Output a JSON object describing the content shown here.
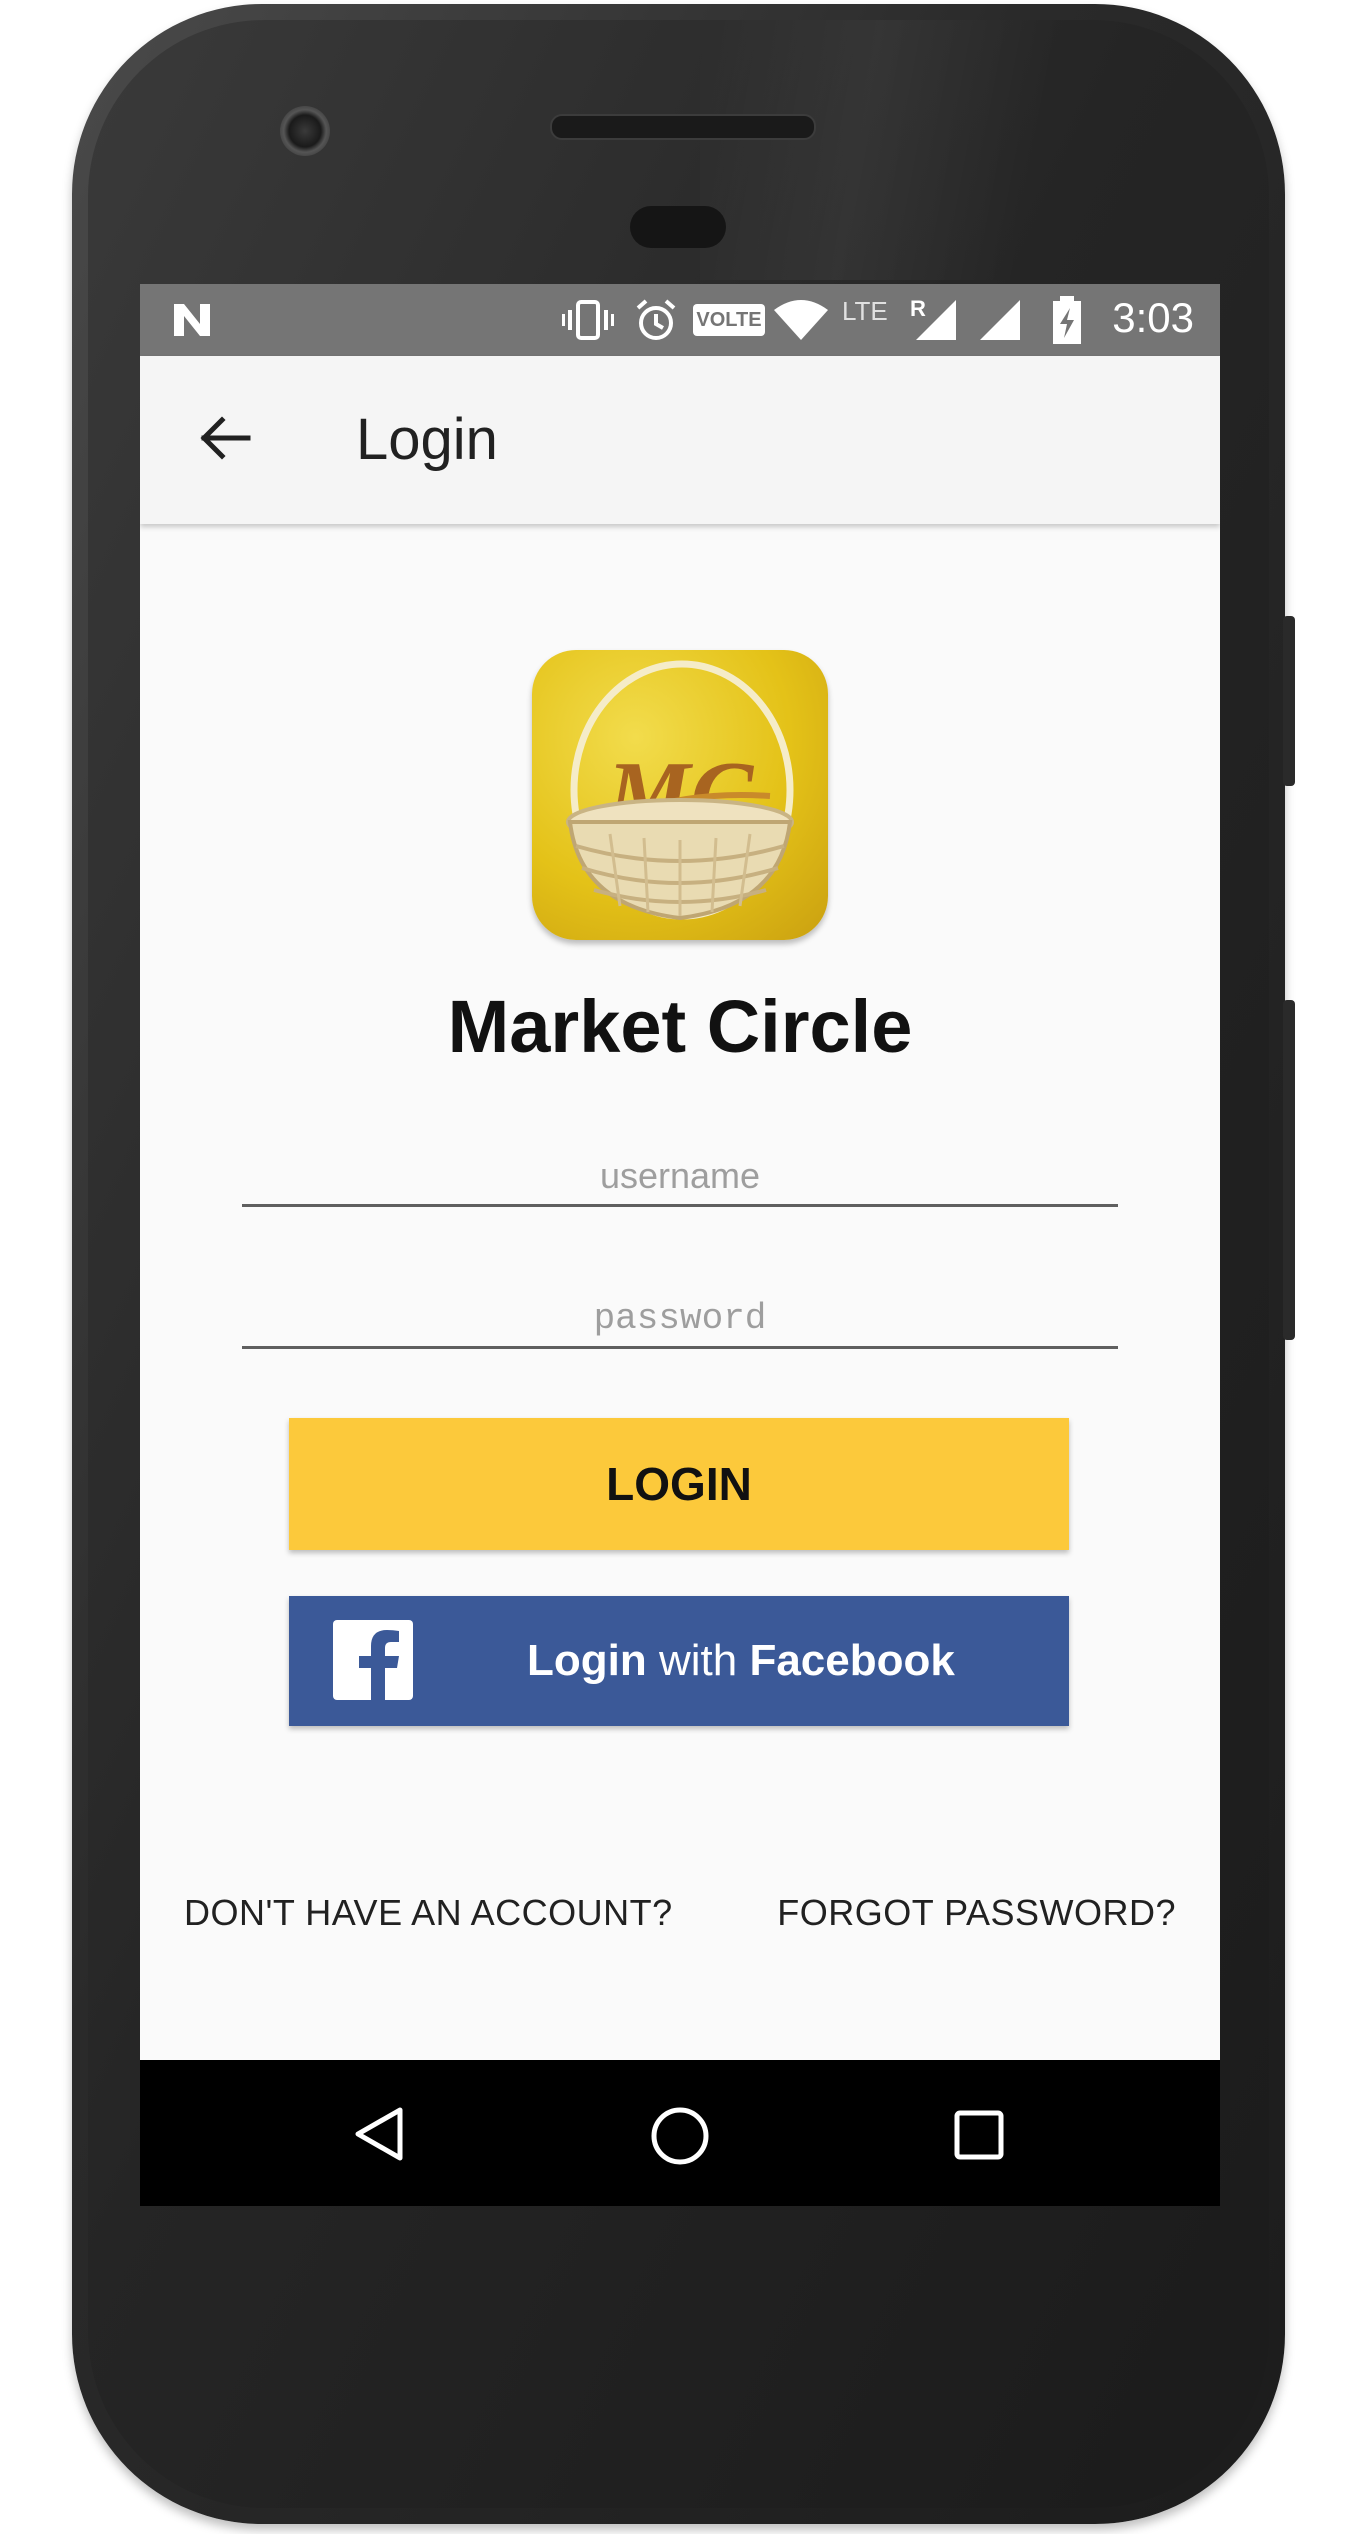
{
  "status_bar": {
    "time": "3:03",
    "volte_label": "VOLTE",
    "lte_label": "LTE",
    "roaming_label": "R"
  },
  "app_bar": {
    "title": "Login"
  },
  "logo": {
    "monogram": "MC"
  },
  "app_name": "Market Circle",
  "form": {
    "username_placeholder": "username",
    "password_placeholder": "password"
  },
  "buttons": {
    "login_label": "LOGIN",
    "facebook_login_prefix": "Login",
    "facebook_login_mid": "with",
    "facebook_login_brand": "Facebook"
  },
  "links": {
    "signup": "DON'T HAVE AN ACCOUNT?",
    "forgot_password": "FORGOT PASSWORD?"
  },
  "colors": {
    "accent_yellow": "#fcc93b",
    "facebook_blue": "#3b5998",
    "status_bar": "#757575",
    "app_bar": "#f5f5f5"
  }
}
